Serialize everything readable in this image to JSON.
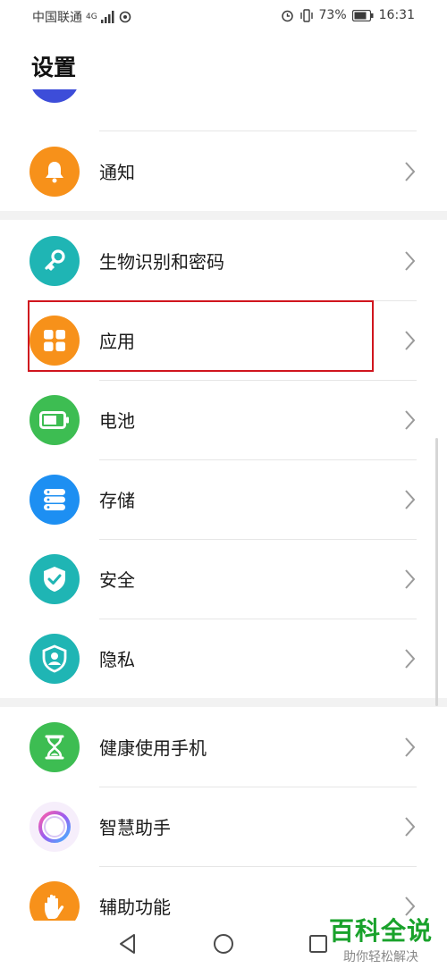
{
  "status_bar": {
    "carrier": "中国联通",
    "network": "4G",
    "battery": "73%",
    "time": "16:31"
  },
  "page_title": "设置",
  "items": [
    {
      "label": "",
      "icon": "sound-icon",
      "color": "#3d4dd9"
    },
    {
      "label": "通知",
      "icon": "bell-icon",
      "color": "#f7911a"
    },
    {
      "label": "生物识别和密码",
      "icon": "key-icon",
      "color": "#1fb5b4"
    },
    {
      "label": "应用",
      "icon": "apps-grid-icon",
      "color": "#f7911a"
    },
    {
      "label": "电池",
      "icon": "battery-icon",
      "color": "#3dbd52"
    },
    {
      "label": "存储",
      "icon": "storage-icon",
      "color": "#1d8ff2"
    },
    {
      "label": "安全",
      "icon": "shield-check-icon",
      "color": "#1fb5b4"
    },
    {
      "label": "隐私",
      "icon": "privacy-icon",
      "color": "#1fb5b4"
    },
    {
      "label": "健康使用手机",
      "icon": "hourglass-icon",
      "color": "#3dbd52"
    },
    {
      "label": "智慧助手",
      "icon": "assistant-icon",
      "color": "#b46bea"
    },
    {
      "label": "辅助功能",
      "icon": "hand-icon",
      "color": "#f7911a"
    }
  ],
  "watermark": {
    "title": "百科全说",
    "subtitle": "助你轻松解决"
  }
}
